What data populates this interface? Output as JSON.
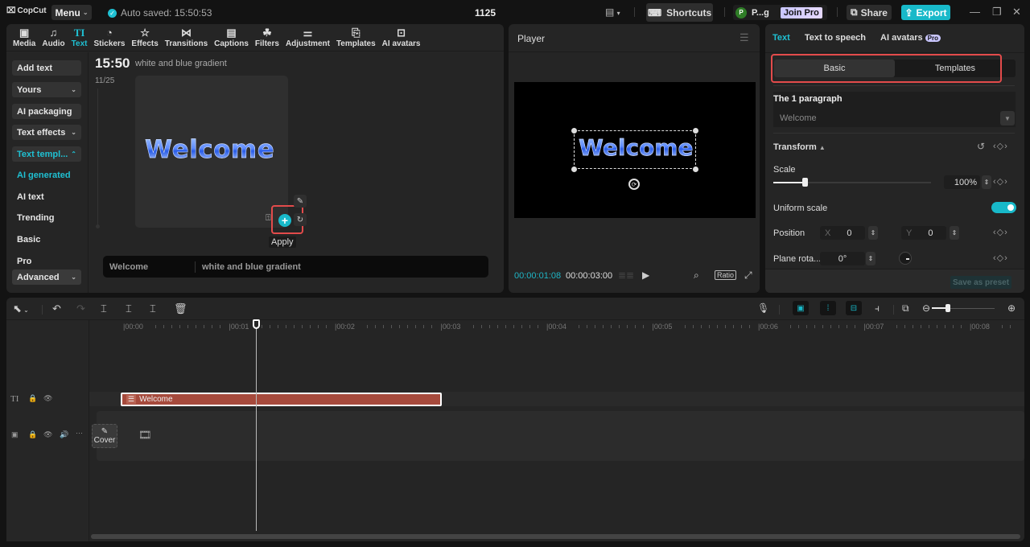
{
  "titlebar": {
    "app_name": "CopCut",
    "menu_label": "Menu",
    "autosave": "Auto saved: 15:50:53",
    "project_name": "1125",
    "shortcuts_label": "Shortcuts",
    "user_initial": "P",
    "user_name": "P...g",
    "join_pro_label": "Join Pro",
    "share_label": "Share",
    "export_label": "Export",
    "accent_color": "#18b9c9"
  },
  "toolbar": {
    "tools": [
      {
        "label": "Media",
        "icon": "media-icon"
      },
      {
        "label": "Audio",
        "icon": "audio-icon"
      },
      {
        "label": "Text",
        "icon": "text-icon",
        "active": true
      },
      {
        "label": "Stickers",
        "icon": "stickers-icon"
      },
      {
        "label": "Effects",
        "icon": "effects-icon"
      },
      {
        "label": "Transitions",
        "icon": "transitions-icon"
      },
      {
        "label": "Captions",
        "icon": "captions-icon"
      },
      {
        "label": "Filters",
        "icon": "filters-icon"
      },
      {
        "label": "Adjustment",
        "icon": "adjustment-icon"
      },
      {
        "label": "Templates",
        "icon": "templates-icon"
      },
      {
        "label": "AI avatars",
        "icon": "ai-avatars-icon"
      }
    ]
  },
  "sidenav": {
    "add_text": "Add text",
    "yours": "Yours",
    "ai_packaging": "AI packaging",
    "text_effects": "Text effects",
    "text_templates": "Text templ...",
    "sub_items": [
      "AI generated",
      "AI text",
      "Trending",
      "Basic",
      "Pro"
    ],
    "advanced": "Advanced"
  },
  "content": {
    "time": "15:50",
    "prompt": "white and blue gradient",
    "date": "11/25",
    "preview_text": "Welcome",
    "apply_tooltip": "Apply",
    "input_text": "Welcome",
    "input_style": "white and blue gradient"
  },
  "player": {
    "title": "Player",
    "preview_text": "Welcome",
    "current_time": "00:00:01:08",
    "total_time": "00:00:03:00",
    "ratio_label": "Ratio"
  },
  "inspector": {
    "tabs": [
      {
        "label": "Text",
        "active": true
      },
      {
        "label": "Text to speech"
      },
      {
        "label": "AI avatars",
        "badge": "Pro"
      }
    ],
    "segments": [
      {
        "label": "Basic",
        "active": true
      },
      {
        "label": "Templates"
      }
    ],
    "paragraph_label": "The 1 paragraph",
    "paragraph_value": "Welcome",
    "transform_label": "Transform",
    "scale_label": "Scale",
    "scale_value": "100%",
    "scale_slider_fraction": 0.2,
    "uniform_scale_label": "Uniform scale",
    "uniform_scale_on": true,
    "position_label": "Position",
    "pos_x_label": "X",
    "pos_x": "0",
    "pos_y_label": "Y",
    "pos_y": "0",
    "rotation_label": "Plane rota...",
    "rotation_value": "0°",
    "save_preset_label": "Save as preset"
  },
  "timeline": {
    "ruler_ticks": [
      "00:00",
      "00:01",
      "00:02",
      "00:03",
      "00:04",
      "00:05",
      "00:06",
      "00:07",
      "00:08"
    ],
    "text_clip_label": "Welcome",
    "cover_label": "Cover",
    "zoom_fraction": 0.25
  }
}
